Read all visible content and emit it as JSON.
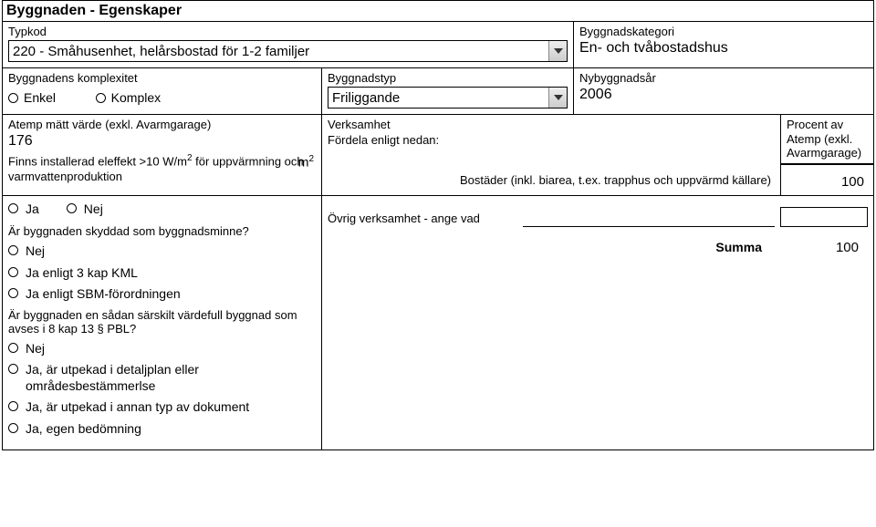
{
  "header": {
    "title": "Byggnaden - Egenskaper"
  },
  "typkod": {
    "label": "Typkod",
    "value": "220 - Småhusenhet, helårsbostad för 1-2 familjer"
  },
  "kategori": {
    "label": "Byggnadskategori",
    "value": "En- och tvåbostadshus"
  },
  "komplexitet": {
    "label": "Byggnadens komplexitet",
    "options": {
      "enkel": "Enkel",
      "komplex": "Komplex"
    }
  },
  "byggnadstyp": {
    "label": "Byggnadstyp",
    "selected": "Friliggande"
  },
  "nybyggnadsar": {
    "label": "Nybyggnadsår",
    "value": "2006"
  },
  "atemp": {
    "label": "Atemp mätt värde (exkl. Avarmgarage)",
    "value": "176",
    "unit_html": "m²",
    "installed_heat_question": "Finns installerad eleffekt >10 W/m² för uppvärmning och varmvattenproduktion",
    "ja": "Ja",
    "nej": "Nej"
  },
  "verksamhet": {
    "label": "Verksamhet",
    "sublabel": "Fördela enligt nedan:",
    "percent_header_line1": "Procent av",
    "percent_header_line2": "Atemp (exkl.",
    "percent_header_line3": "Avarmgarage)",
    "row_bostader_label": "Bostäder (inkl. biarea, t.ex. trapphus och uppvärmd källare)",
    "row_bostader_value": "100",
    "ovrig_label": "Övrig verksamhet - ange vad",
    "ovrig_text": "",
    "ovrig_value": "",
    "summa_label": "Summa",
    "summa_value": "100"
  },
  "skyddad": {
    "question": "Är byggnaden skyddad som byggnadsminne?",
    "nej": "Nej",
    "ja_kml": "Ja enligt 3 kap KML",
    "ja_sbm": "Ja enligt SBM-förordningen"
  },
  "pbl": {
    "question": "Är byggnaden en sådan särskilt värdefull byggnad som avses i 8 kap 13 § PBL?",
    "nej": "Nej",
    "ja_detaljplan": "Ja, är utpekad i detaljplan eller områdesbestämmerlse",
    "ja_annan": "Ja, är utpekad i annan typ av dokument",
    "ja_egen": "Ja, egen bedömning"
  }
}
